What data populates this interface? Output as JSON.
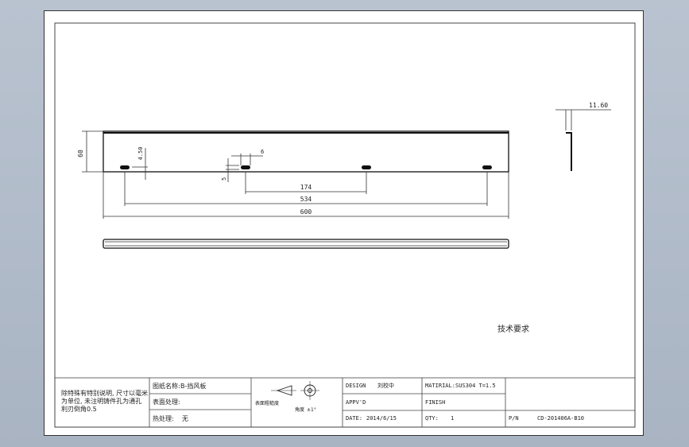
{
  "dimensions": {
    "height": "60",
    "hole_offset_v": "4.50",
    "hole_width": "6",
    "hole_height": "5",
    "pitch_1": "174",
    "pitch_2": "534",
    "length": "600",
    "side_flange": "11.60"
  },
  "technical_requirements": "技术要求",
  "title_block": {
    "notes_lines": [
      "除特殊有特别说明, 尺寸以毫米",
      "为单位, 未注明铸件孔为通孔",
      "利刃倒角0.5"
    ],
    "part_name_label": "图纸名称:",
    "part_name": "B-挡风板",
    "surface_label": "表面处理:",
    "heat_label": "热处理:",
    "heat_value": "无",
    "roughness_label": "表面粗糙度",
    "tolerance_label": "角度",
    "tolerance_value": "±1°",
    "design_label": "DESIGN",
    "design_value": "刘校中",
    "material_label": "MATIRIAL:",
    "material_value": "SUS304 T=1.5",
    "approved_label": "APPV'D",
    "finish_label": "FINISH",
    "date_label": "DATE:",
    "date_value": "2014/6/15",
    "qty_label": "QTY:",
    "qty_value": "1",
    "pn_label": "P/N",
    "pn_value": "CD-201406A-B10"
  }
}
